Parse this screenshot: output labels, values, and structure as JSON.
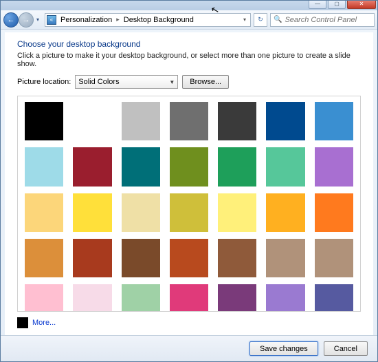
{
  "window": {
    "minimize": "—",
    "maximize": "▢",
    "close": "✕"
  },
  "nav": {
    "back": "←",
    "forward": "→",
    "history_dd": "▾",
    "icon_text": "«",
    "crumbs": [
      "Personalization",
      "Desktop Background"
    ],
    "crumb_sep": "▸",
    "addr_dd": "▾",
    "refresh": "↻",
    "search_placeholder": "Search Control Panel",
    "search_icon": "🔍"
  },
  "main": {
    "title": "Choose your desktop background",
    "subtitle": "Click a picture to make it your desktop background, or select more than one picture to create a slide show.",
    "location_label": "Picture location:",
    "location_value": "Solid Colors",
    "browse_label": "Browse...",
    "more_label": "More...",
    "colors": [
      "#000000",
      "#ffffff",
      "#c0c0c0",
      "#6f6f6f",
      "#3a3a3a",
      "#004a8f",
      "#3a8fd1",
      "#9edbe8",
      "#9a1e2e",
      "#006f78",
      "#6f8f1e",
      "#1e9f5a",
      "#56c79a",
      "#a86fd1",
      "#fcd67a",
      "#ffe03a",
      "#efe0a6",
      "#cfbf3a",
      "#fff07a",
      "#ffb020",
      "#ff7a1e",
      "#dc8f3a",
      "#a83a1e",
      "#7a4a2a",
      "#b84a1e",
      "#8f5a3a",
      "#b0927a",
      "#b0927a",
      "#ffbfd1",
      "#f7dbe8",
      "#9fd1a6",
      "#e03a7a",
      "#7a3a7a",
      "#9a7ad1",
      "#565aa0"
    ],
    "more_swatch": "#000000"
  },
  "footer": {
    "save": "Save changes",
    "cancel": "Cancel"
  }
}
